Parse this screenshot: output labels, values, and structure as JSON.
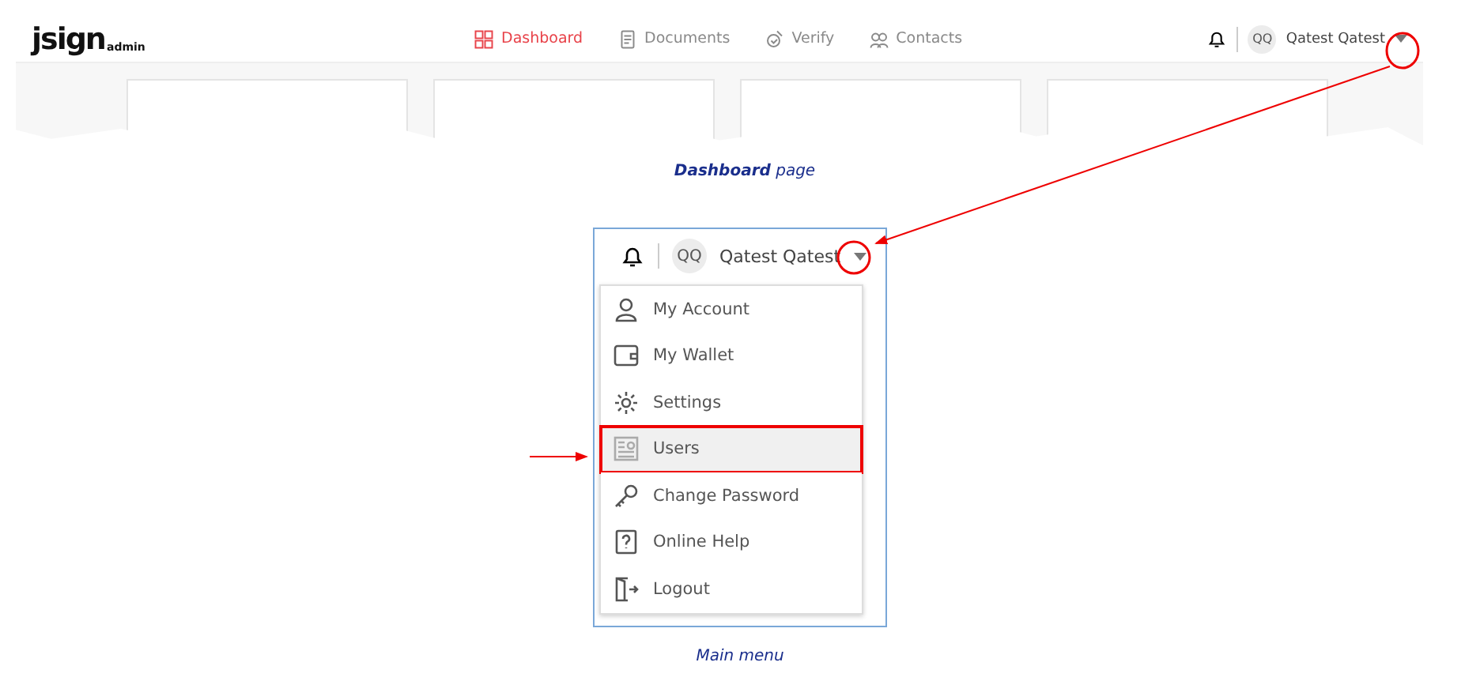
{
  "dashboard_screenshot": {
    "logo": {
      "name": "jsign",
      "sub": "admin"
    },
    "nav": [
      {
        "label": "Dashboard",
        "selected": true
      },
      {
        "label": "Documents",
        "selected": false
      },
      {
        "label": "Verify",
        "selected": false
      },
      {
        "label": "Contacts",
        "selected": false
      }
    ],
    "user": {
      "initials": "QQ",
      "name": "Qatest Qatest"
    }
  },
  "caption_top": "**Dashboard** page",
  "menu_screenshot": {
    "user": {
      "initials": "QQ",
      "name": "Qatest Qatest"
    },
    "items": [
      {
        "label": "My Account",
        "selected": false
      },
      {
        "label": "My Wallet",
        "selected": false
      },
      {
        "label": "Settings",
        "selected": false
      },
      {
        "label": "Users",
        "selected": true
      },
      {
        "label": "Change Password",
        "selected": false
      },
      {
        "label": "Online Help",
        "selected": false
      },
      {
        "label": "Logout",
        "selected": false
      }
    ]
  },
  "caption_bottom": "Main menu"
}
